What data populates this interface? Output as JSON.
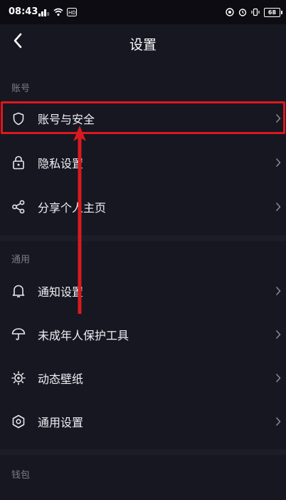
{
  "status_bar": {
    "time": "08:43",
    "battery": "68"
  },
  "header": {
    "title": "设置"
  },
  "sections": {
    "account": {
      "label": "账号",
      "items": [
        {
          "label": "账号与安全",
          "icon": "shield-icon"
        },
        {
          "label": "隐私设置",
          "icon": "lock-icon"
        },
        {
          "label": "分享个人主页",
          "icon": "share-icon"
        }
      ]
    },
    "general": {
      "label": "通用",
      "items": [
        {
          "label": "通知设置",
          "icon": "bell-icon"
        },
        {
          "label": "未成年人保护工具",
          "icon": "umbrella-icon"
        },
        {
          "label": "动态壁纸",
          "icon": "wallpaper-icon"
        },
        {
          "label": "通用设置",
          "icon": "hexagon-icon"
        }
      ]
    },
    "wallet": {
      "label": "钱包"
    }
  },
  "colors": {
    "background": "#161721",
    "highlight": "#e0161e",
    "text": "#f0f0f4",
    "section_label": "#7d7e88"
  }
}
